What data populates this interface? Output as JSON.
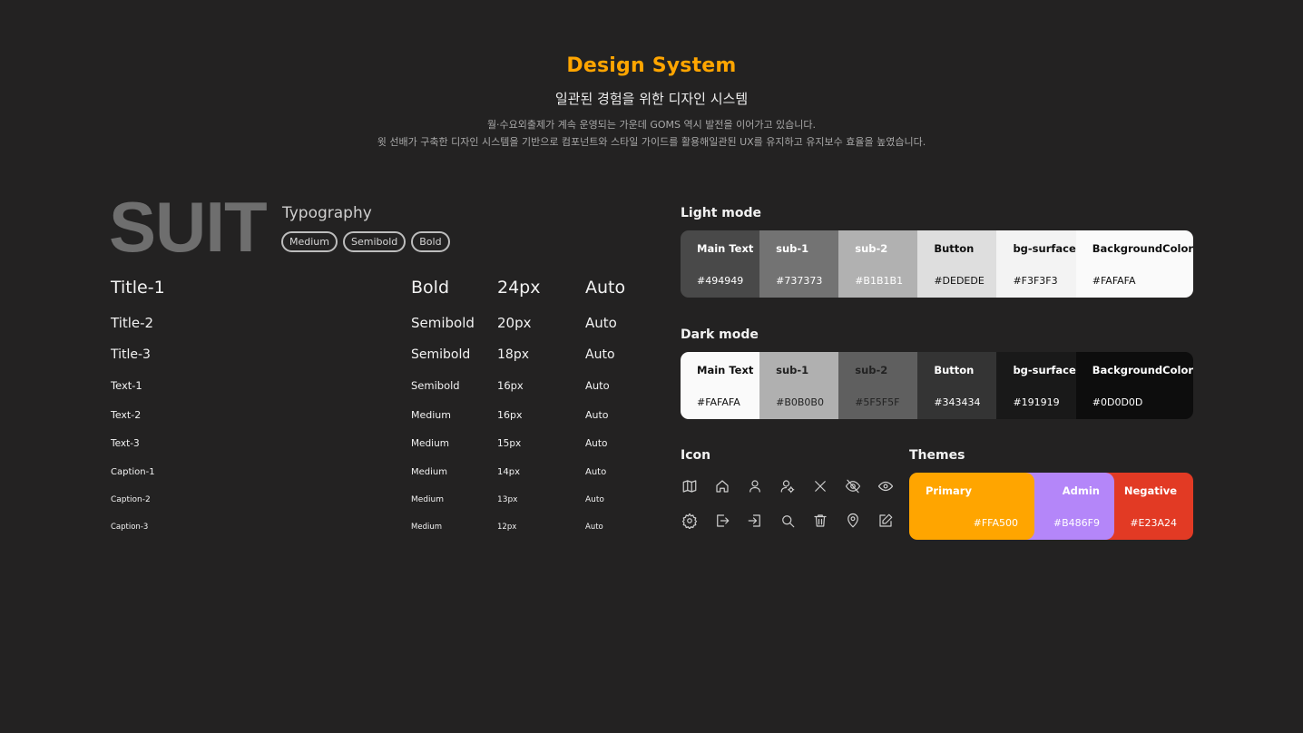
{
  "header": {
    "title": "Design System",
    "subtitle": "일관된 경험을 위한 디자인 시스템",
    "desc_line1": "월·수요외출제가 계속 운영되는 가운데 GOMS 역시 발전을 이어가고 있습니다.",
    "desc_line2": "윗 선배가 구축한 디자인 시스템을 기반으로 컴포넌트와 스타일 가이드를 활용해일관된 UX를 유지하고 유지보수 효율을 높였습니다."
  },
  "typography": {
    "font_name": "SUIT",
    "label": "Typography",
    "weights": [
      "Medium",
      "Semibold",
      "Bold"
    ],
    "rows": [
      {
        "name": "Title-1",
        "weight": "Bold",
        "size": "24px",
        "line": "Auto"
      },
      {
        "name": "Title-2",
        "weight": "Semibold",
        "size": "20px",
        "line": "Auto"
      },
      {
        "name": "Title-3",
        "weight": "Semibold",
        "size": "18px",
        "line": "Auto"
      },
      {
        "name": "Text-1",
        "weight": "Semibold",
        "size": "16px",
        "line": "Auto"
      },
      {
        "name": "Text-2",
        "weight": "Medium",
        "size": "16px",
        "line": "Auto"
      },
      {
        "name": "Text-3",
        "weight": "Medium",
        "size": "15px",
        "line": "Auto"
      },
      {
        "name": "Caption-1",
        "weight": "Medium",
        "size": "14px",
        "line": "Auto"
      },
      {
        "name": "Caption-2",
        "weight": "Medium",
        "size": "13px",
        "line": "Auto"
      },
      {
        "name": "Caption-3",
        "weight": "Medium",
        "size": "12px",
        "line": "Auto"
      }
    ]
  },
  "light_mode": {
    "label": "Light mode",
    "swatches": [
      {
        "name": "Main Text",
        "hex": "#494949",
        "text_color": "#ffffff"
      },
      {
        "name": "sub-1",
        "hex": "#737373",
        "text_color": "#ffffff"
      },
      {
        "name": "sub-2",
        "hex": "#B1B1B1",
        "text_color": "#ffffff"
      },
      {
        "name": "Button",
        "hex": "#DEDEDE",
        "text_color": "#111111"
      },
      {
        "name": "bg-surface",
        "hex": "#F3F3F3",
        "text_color": "#111111"
      },
      {
        "name": "BackgroundColor",
        "hex": "#FAFAFA",
        "text_color": "#111111"
      }
    ]
  },
  "dark_mode": {
    "label": "Dark mode",
    "swatches": [
      {
        "name": "Main Text",
        "hex": "#FAFAFA",
        "text_color": "#111111"
      },
      {
        "name": "sub-1",
        "hex": "#B0B0B0",
        "text_color": "#222222"
      },
      {
        "name": "sub-2",
        "hex": "#5F5F5F",
        "text_color": "#222222"
      },
      {
        "name": "Button",
        "hex": "#343434",
        "text_color": "#ffffff"
      },
      {
        "name": "bg-surface",
        "hex": "#191919",
        "text_color": "#ffffff"
      },
      {
        "name": "BackgroundColor",
        "hex": "#0D0D0D",
        "text_color": "#ffffff"
      }
    ]
  },
  "icons": {
    "label": "Icon",
    "items": [
      "map-icon",
      "home-icon",
      "user-icon",
      "user-settings-icon",
      "close-icon",
      "eye-off-icon",
      "eye-icon",
      "settings-icon",
      "logout-icon",
      "login-icon",
      "search-icon",
      "trash-icon",
      "location-pin-icon",
      "edit-icon"
    ]
  },
  "themes": {
    "label": "Themes",
    "items": [
      {
        "name": "Primary",
        "hex": "#FFA500"
      },
      {
        "name": "Admin",
        "hex": "#B486F9"
      },
      {
        "name": "Negative",
        "hex": "#E23A24"
      }
    ]
  }
}
